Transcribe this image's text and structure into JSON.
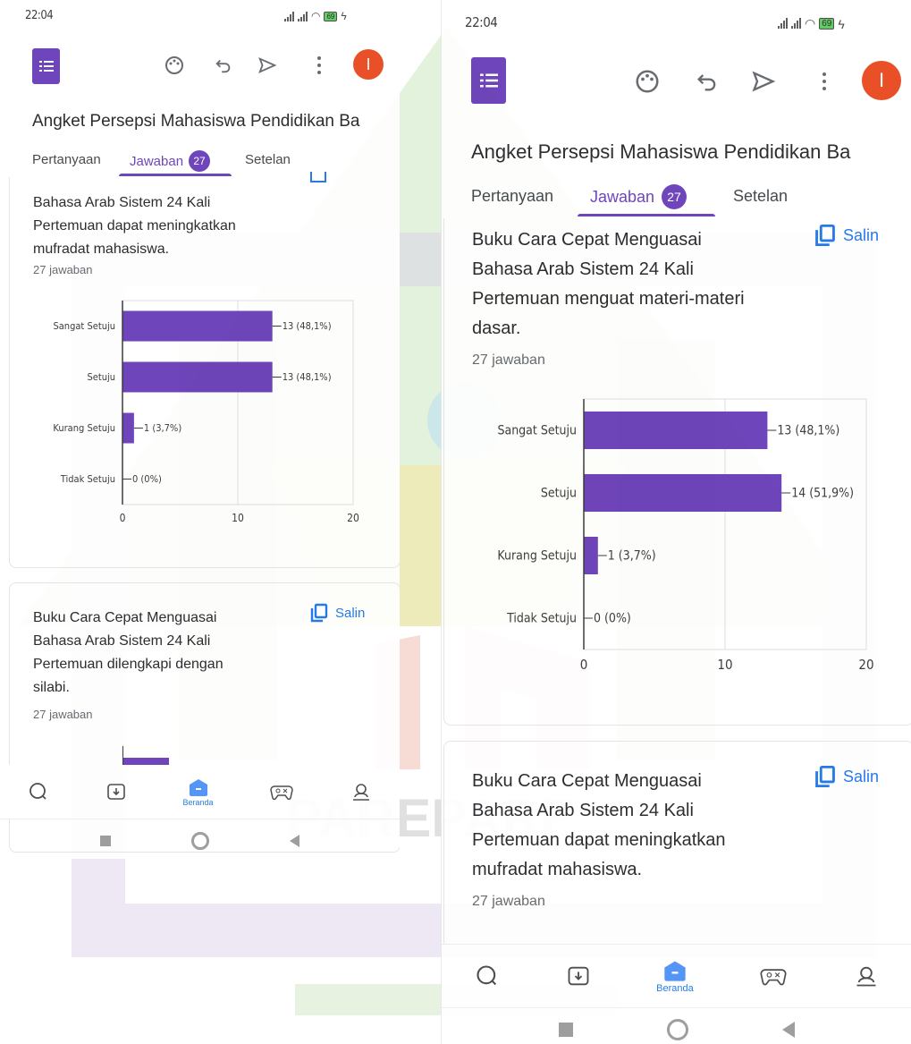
{
  "watermark": {
    "text": "PAREPARE"
  },
  "screens": [
    {
      "status_time": "22:04",
      "battery": "69",
      "form_title": "Angket Persepsi Mahasiswa Pendidikan Ba",
      "tabs": [
        {
          "label": "Pertanyaan"
        },
        {
          "label": "Jawaban",
          "badge": "27"
        },
        {
          "label": "Setelan"
        }
      ],
      "cards": [
        {
          "question": [
            "Bahasa Arab Sistem 24 Kali",
            "Pertemuan dapat meningkatkan",
            "mufradat mahasiswa."
          ],
          "responses": "27 jawaban"
        },
        {
          "question": [
            "Buku Cara Cepat Menguasai",
            "Bahasa Arab Sistem 24 Kali",
            "Pertemuan dilengkapi dengan",
            "silabi."
          ],
          "responses": "27 jawaban",
          "copy_label": "Salin"
        }
      ],
      "bottom_nav": {
        "active_label": "Beranda"
      }
    },
    {
      "status_time": "22:04",
      "battery": "69",
      "form_title": "Angket Persepsi Mahasiswa Pendidikan Ba",
      "tabs": [
        {
          "label": "Pertanyaan"
        },
        {
          "label": "Jawaban",
          "badge": "27"
        },
        {
          "label": "Setelan"
        }
      ],
      "cards": [
        {
          "question": [
            "Buku Cara Cepat Menguasai",
            "Bahasa Arab Sistem 24 Kali",
            "Pertemuan menguat materi-materi",
            "dasar."
          ],
          "responses": "27 jawaban",
          "copy_label": "Salin"
        },
        {
          "question": [
            "Buku Cara Cepat Menguasai",
            "Bahasa Arab Sistem 24 Kali",
            "Pertemuan dapat meningkatkan",
            "mufradat mahasiswa."
          ],
          "responses": "27 jawaban",
          "copy_label": "Salin"
        }
      ],
      "bottom_nav": {
        "active_label": "Beranda"
      }
    }
  ],
  "chart_data": [
    {
      "type": "bar",
      "orientation": "horizontal",
      "categories": [
        "Sangat Setuju",
        "Setuju",
        "Kurang Setuju",
        "Tidak Setuju"
      ],
      "values": [
        13,
        13,
        1,
        0
      ],
      "value_labels": [
        "13 (48,1%)",
        "13 (48,1%)",
        "1 (3,7%)",
        "0 (0%)"
      ],
      "xlim": [
        0,
        20
      ],
      "xticks": [
        "0",
        "10",
        "20"
      ],
      "grid": true,
      "color": "#673ab7"
    },
    {
      "type": "bar",
      "orientation": "horizontal",
      "categories": [
        "Sangat Setuju",
        "Setuju",
        "Kurang Setuju",
        "Tidak Setuju"
      ],
      "values": [
        13,
        14,
        1,
        0
      ],
      "value_labels": [
        "13 (48,1%)",
        "14 (51,9%)",
        "1 (3,7%)",
        "0 (0%)"
      ],
      "xlim": [
        0,
        20
      ],
      "xticks": [
        "0",
        "10",
        "20"
      ],
      "grid": true,
      "color": "#673ab7"
    },
    {
      "type": "bar",
      "orientation": "horizontal",
      "note_partial": "only top of first bar visible",
      "categories": [],
      "values": [],
      "color": "#673ab7"
    }
  ]
}
